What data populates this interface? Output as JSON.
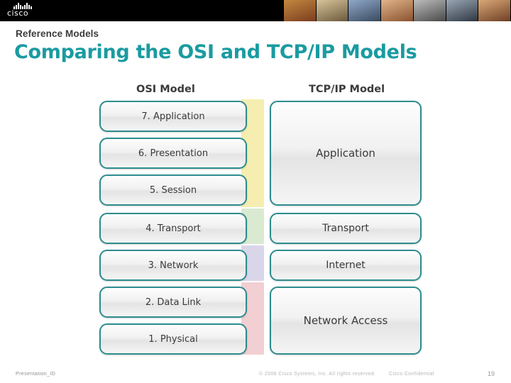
{
  "banner": {
    "logo_name": "cisco-logo",
    "logo_text": "cisco",
    "photo_count": 7
  },
  "header": {
    "eyebrow": "Reference Models",
    "title": "Comparing the OSI and TCP/IP Models",
    "title_color": "#1a9ba1"
  },
  "diagram": {
    "osi_heading": "OSI Model",
    "tcpip_heading": "TCP/IP Model",
    "osi_layers": [
      {
        "label": "7. Application",
        "stripe_color": "#f6eeb0"
      },
      {
        "label": "6. Presentation",
        "stripe_color": "#f6eeb0"
      },
      {
        "label": "5. Session",
        "stripe_color": "#f6eeb0"
      },
      {
        "label": "4. Transport",
        "stripe_color": "#d9ead0"
      },
      {
        "label": "3. Network",
        "stripe_color": "#d9d6ea"
      },
      {
        "label": "2. Data Link",
        "stripe_color": "#f2cfd2"
      },
      {
        "label": "1. Physical",
        "stripe_color": "#f2cfd2"
      }
    ],
    "tcpip_layers": [
      {
        "label": "Application",
        "spans": 3
      },
      {
        "label": "Transport",
        "spans": 1
      },
      {
        "label": "Internet",
        "spans": 1
      },
      {
        "label": "Network Access",
        "spans": 2
      }
    ],
    "box_border_color": "#2e8c8e"
  },
  "footer": {
    "presentation_id": "Presentation_ID",
    "copyright": "© 2008 Cisco Systems, Inc. All rights reserved.",
    "confidential": "Cisco Confidential",
    "page_number": "19"
  }
}
